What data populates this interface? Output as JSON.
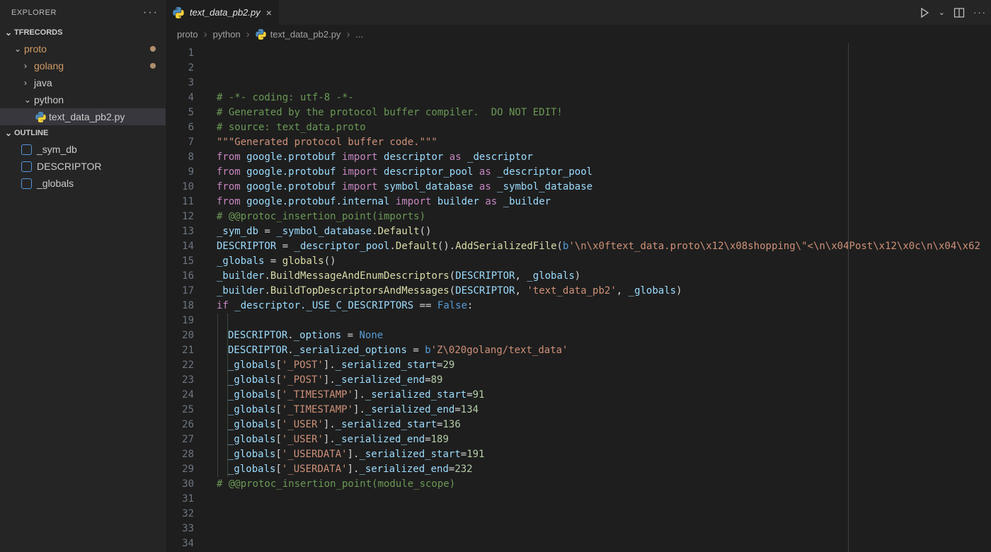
{
  "sidebar": {
    "header": "EXPLORER",
    "sections": {
      "tfrecords": {
        "title": "TFRECORDS",
        "items": [
          {
            "label": "proto",
            "kind": "folder",
            "depth": 1,
            "expanded": true,
            "orange": true,
            "dirty": true
          },
          {
            "label": "golang",
            "kind": "folder",
            "depth": 2,
            "expanded": false,
            "orange": true,
            "dirty": true
          },
          {
            "label": "java",
            "kind": "folder",
            "depth": 2,
            "expanded": false
          },
          {
            "label": "python",
            "kind": "folder",
            "depth": 2,
            "expanded": true
          },
          {
            "label": "text_data_pb2.py",
            "kind": "file",
            "depth": 3,
            "selected": true
          }
        ]
      },
      "outline": {
        "title": "OUTLINE",
        "items": [
          {
            "label": "_sym_db"
          },
          {
            "label": "DESCRIPTOR"
          },
          {
            "label": "_globals"
          }
        ]
      }
    }
  },
  "tabs": [
    {
      "label": "text_data_pb2.py",
      "active": true
    }
  ],
  "breadcrumb": {
    "segments": [
      "proto",
      "python",
      "text_data_pb2.py",
      "..."
    ]
  },
  "code": {
    "lines": [
      {
        "n": 1,
        "t": [
          [
            "c",
            "# -*- coding: utf-8 -*-"
          ]
        ]
      },
      {
        "n": 2,
        "t": [
          [
            "c",
            "# Generated by the protocol buffer compiler.  DO NOT EDIT!"
          ]
        ]
      },
      {
        "n": 3,
        "t": [
          [
            "c",
            "# source: text_data.proto"
          ]
        ]
      },
      {
        "n": 4,
        "t": [
          [
            "s",
            "\"\"\"Generated protocol buffer code.\"\"\""
          ]
        ]
      },
      {
        "n": 5,
        "t": [
          [
            "k",
            "from"
          ],
          [
            "d",
            " "
          ],
          [
            "n",
            "google.protobuf"
          ],
          [
            "d",
            " "
          ],
          [
            "k",
            "import"
          ],
          [
            "d",
            " "
          ],
          [
            "n",
            "descriptor"
          ],
          [
            "d",
            " "
          ],
          [
            "k",
            "as"
          ],
          [
            "d",
            " "
          ],
          [
            "n",
            "_descriptor"
          ]
        ]
      },
      {
        "n": 6,
        "t": [
          [
            "k",
            "from"
          ],
          [
            "d",
            " "
          ],
          [
            "n",
            "google.protobuf"
          ],
          [
            "d",
            " "
          ],
          [
            "k",
            "import"
          ],
          [
            "d",
            " "
          ],
          [
            "n",
            "descriptor_pool"
          ],
          [
            "d",
            " "
          ],
          [
            "k",
            "as"
          ],
          [
            "d",
            " "
          ],
          [
            "n",
            "_descriptor_pool"
          ]
        ]
      },
      {
        "n": 7,
        "t": [
          [
            "k",
            "from"
          ],
          [
            "d",
            " "
          ],
          [
            "n",
            "google.protobuf"
          ],
          [
            "d",
            " "
          ],
          [
            "k",
            "import"
          ],
          [
            "d",
            " "
          ],
          [
            "n",
            "symbol_database"
          ],
          [
            "d",
            " "
          ],
          [
            "k",
            "as"
          ],
          [
            "d",
            " "
          ],
          [
            "n",
            "_symbol_database"
          ]
        ]
      },
      {
        "n": 8,
        "t": [
          [
            "k",
            "from"
          ],
          [
            "d",
            " "
          ],
          [
            "n",
            "google.protobuf.internal"
          ],
          [
            "d",
            " "
          ],
          [
            "k",
            "import"
          ],
          [
            "d",
            " "
          ],
          [
            "n",
            "builder"
          ],
          [
            "d",
            " "
          ],
          [
            "k",
            "as"
          ],
          [
            "d",
            " "
          ],
          [
            "n",
            "_builder"
          ]
        ]
      },
      {
        "n": 9,
        "t": [
          [
            "c",
            "# @@protoc_insertion_point(imports)"
          ]
        ]
      },
      {
        "n": 10,
        "t": [
          [
            "d",
            ""
          ]
        ]
      },
      {
        "n": 11,
        "t": [
          [
            "n",
            "_sym_db"
          ],
          [
            "d",
            " = "
          ],
          [
            "n",
            "_symbol_database"
          ],
          [
            "d",
            "."
          ],
          [
            "f",
            "Default"
          ],
          [
            "d",
            "()"
          ]
        ]
      },
      {
        "n": 12,
        "t": [
          [
            "d",
            ""
          ]
        ]
      },
      {
        "n": 13,
        "t": [
          [
            "d",
            ""
          ]
        ]
      },
      {
        "n": 14,
        "t": [
          [
            "d",
            ""
          ]
        ]
      },
      {
        "n": 15,
        "t": [
          [
            "d",
            ""
          ]
        ]
      },
      {
        "n": 16,
        "t": [
          [
            "n",
            "DESCRIPTOR"
          ],
          [
            "d",
            " = "
          ],
          [
            "n",
            "_descriptor_pool"
          ],
          [
            "d",
            "."
          ],
          [
            "f",
            "Default"
          ],
          [
            "d",
            "()."
          ],
          [
            "f",
            "AddSerializedFile"
          ],
          [
            "d",
            "("
          ],
          [
            "b",
            "b"
          ],
          [
            "s",
            "'\\n\\x0ftext_data.proto\\x12\\x08shopping\\\"<\\n\\x04Post\\x12\\x0c\\n\\x04\\x62"
          ]
        ]
      },
      {
        "n": 17,
        "t": [
          [
            "d",
            ""
          ]
        ]
      },
      {
        "n": 18,
        "t": [
          [
            "n",
            "_globals"
          ],
          [
            "d",
            " = "
          ],
          [
            "f",
            "globals"
          ],
          [
            "d",
            "()"
          ]
        ]
      },
      {
        "n": 19,
        "t": [
          [
            "n",
            "_builder"
          ],
          [
            "d",
            "."
          ],
          [
            "f",
            "BuildMessageAndEnumDescriptors"
          ],
          [
            "d",
            "("
          ],
          [
            "n",
            "DESCRIPTOR"
          ],
          [
            "d",
            ", "
          ],
          [
            "n",
            "_globals"
          ],
          [
            "d",
            ")"
          ]
        ]
      },
      {
        "n": 20,
        "t": [
          [
            "n",
            "_builder"
          ],
          [
            "d",
            "."
          ],
          [
            "f",
            "BuildTopDescriptorsAndMessages"
          ],
          [
            "d",
            "("
          ],
          [
            "n",
            "DESCRIPTOR"
          ],
          [
            "d",
            ", "
          ],
          [
            "s",
            "'text_data_pb2'"
          ],
          [
            "d",
            ", "
          ],
          [
            "n",
            "_globals"
          ],
          [
            "d",
            ")"
          ]
        ]
      },
      {
        "n": 21,
        "t": [
          [
            "k",
            "if"
          ],
          [
            "d",
            " "
          ],
          [
            "n",
            "_descriptor._USE_C_DESCRIPTORS"
          ],
          [
            "d",
            " == "
          ],
          [
            "b",
            "False"
          ],
          [
            "d",
            ":"
          ]
        ]
      },
      {
        "n": 22,
        "indent": 1,
        "t": [
          [
            "d",
            ""
          ]
        ]
      },
      {
        "n": 23,
        "indent": 1,
        "t": [
          [
            "n",
            "DESCRIPTOR"
          ],
          [
            "d",
            "."
          ],
          [
            "n",
            "_options"
          ],
          [
            "d",
            " = "
          ],
          [
            "b",
            "None"
          ]
        ]
      },
      {
        "n": 24,
        "indent": 1,
        "t": [
          [
            "n",
            "DESCRIPTOR"
          ],
          [
            "d",
            "."
          ],
          [
            "n",
            "_serialized_options"
          ],
          [
            "d",
            " = "
          ],
          [
            "b",
            "b"
          ],
          [
            "s",
            "'Z\\020golang/text_data'"
          ]
        ]
      },
      {
        "n": 25,
        "indent": 1,
        "t": [
          [
            "n",
            "_globals"
          ],
          [
            "d",
            "["
          ],
          [
            "s",
            "'_POST'"
          ],
          [
            "d",
            "]."
          ],
          [
            "n",
            "_serialized_start"
          ],
          [
            "d",
            "="
          ],
          [
            "m",
            "29"
          ]
        ]
      },
      {
        "n": 26,
        "indent": 1,
        "t": [
          [
            "n",
            "_globals"
          ],
          [
            "d",
            "["
          ],
          [
            "s",
            "'_POST'"
          ],
          [
            "d",
            "]."
          ],
          [
            "n",
            "_serialized_end"
          ],
          [
            "d",
            "="
          ],
          [
            "m",
            "89"
          ]
        ]
      },
      {
        "n": 27,
        "indent": 1,
        "t": [
          [
            "n",
            "_globals"
          ],
          [
            "d",
            "["
          ],
          [
            "s",
            "'_TIMESTAMP'"
          ],
          [
            "d",
            "]."
          ],
          [
            "n",
            "_serialized_start"
          ],
          [
            "d",
            "="
          ],
          [
            "m",
            "91"
          ]
        ]
      },
      {
        "n": 28,
        "indent": 1,
        "t": [
          [
            "n",
            "_globals"
          ],
          [
            "d",
            "["
          ],
          [
            "s",
            "'_TIMESTAMP'"
          ],
          [
            "d",
            "]."
          ],
          [
            "n",
            "_serialized_end"
          ],
          [
            "d",
            "="
          ],
          [
            "m",
            "134"
          ]
        ]
      },
      {
        "n": 29,
        "indent": 1,
        "t": [
          [
            "n",
            "_globals"
          ],
          [
            "d",
            "["
          ],
          [
            "s",
            "'_USER'"
          ],
          [
            "d",
            "]."
          ],
          [
            "n",
            "_serialized_start"
          ],
          [
            "d",
            "="
          ],
          [
            "m",
            "136"
          ]
        ]
      },
      {
        "n": 30,
        "indent": 1,
        "t": [
          [
            "n",
            "_globals"
          ],
          [
            "d",
            "["
          ],
          [
            "s",
            "'_USER'"
          ],
          [
            "d",
            "]."
          ],
          [
            "n",
            "_serialized_end"
          ],
          [
            "d",
            "="
          ],
          [
            "m",
            "189"
          ]
        ]
      },
      {
        "n": 31,
        "indent": 1,
        "t": [
          [
            "n",
            "_globals"
          ],
          [
            "d",
            "["
          ],
          [
            "s",
            "'_USERDATA'"
          ],
          [
            "d",
            "]."
          ],
          [
            "n",
            "_serialized_start"
          ],
          [
            "d",
            "="
          ],
          [
            "m",
            "191"
          ]
        ]
      },
      {
        "n": 32,
        "indent": 1,
        "t": [
          [
            "n",
            "_globals"
          ],
          [
            "d",
            "["
          ],
          [
            "s",
            "'_USERDATA'"
          ],
          [
            "d",
            "]."
          ],
          [
            "n",
            "_serialized_end"
          ],
          [
            "d",
            "="
          ],
          [
            "m",
            "232"
          ]
        ]
      },
      {
        "n": 33,
        "t": [
          [
            "c",
            "# @@protoc_insertion_point(module_scope)"
          ]
        ]
      },
      {
        "n": 34,
        "t": [
          [
            "d",
            ""
          ]
        ]
      }
    ]
  }
}
